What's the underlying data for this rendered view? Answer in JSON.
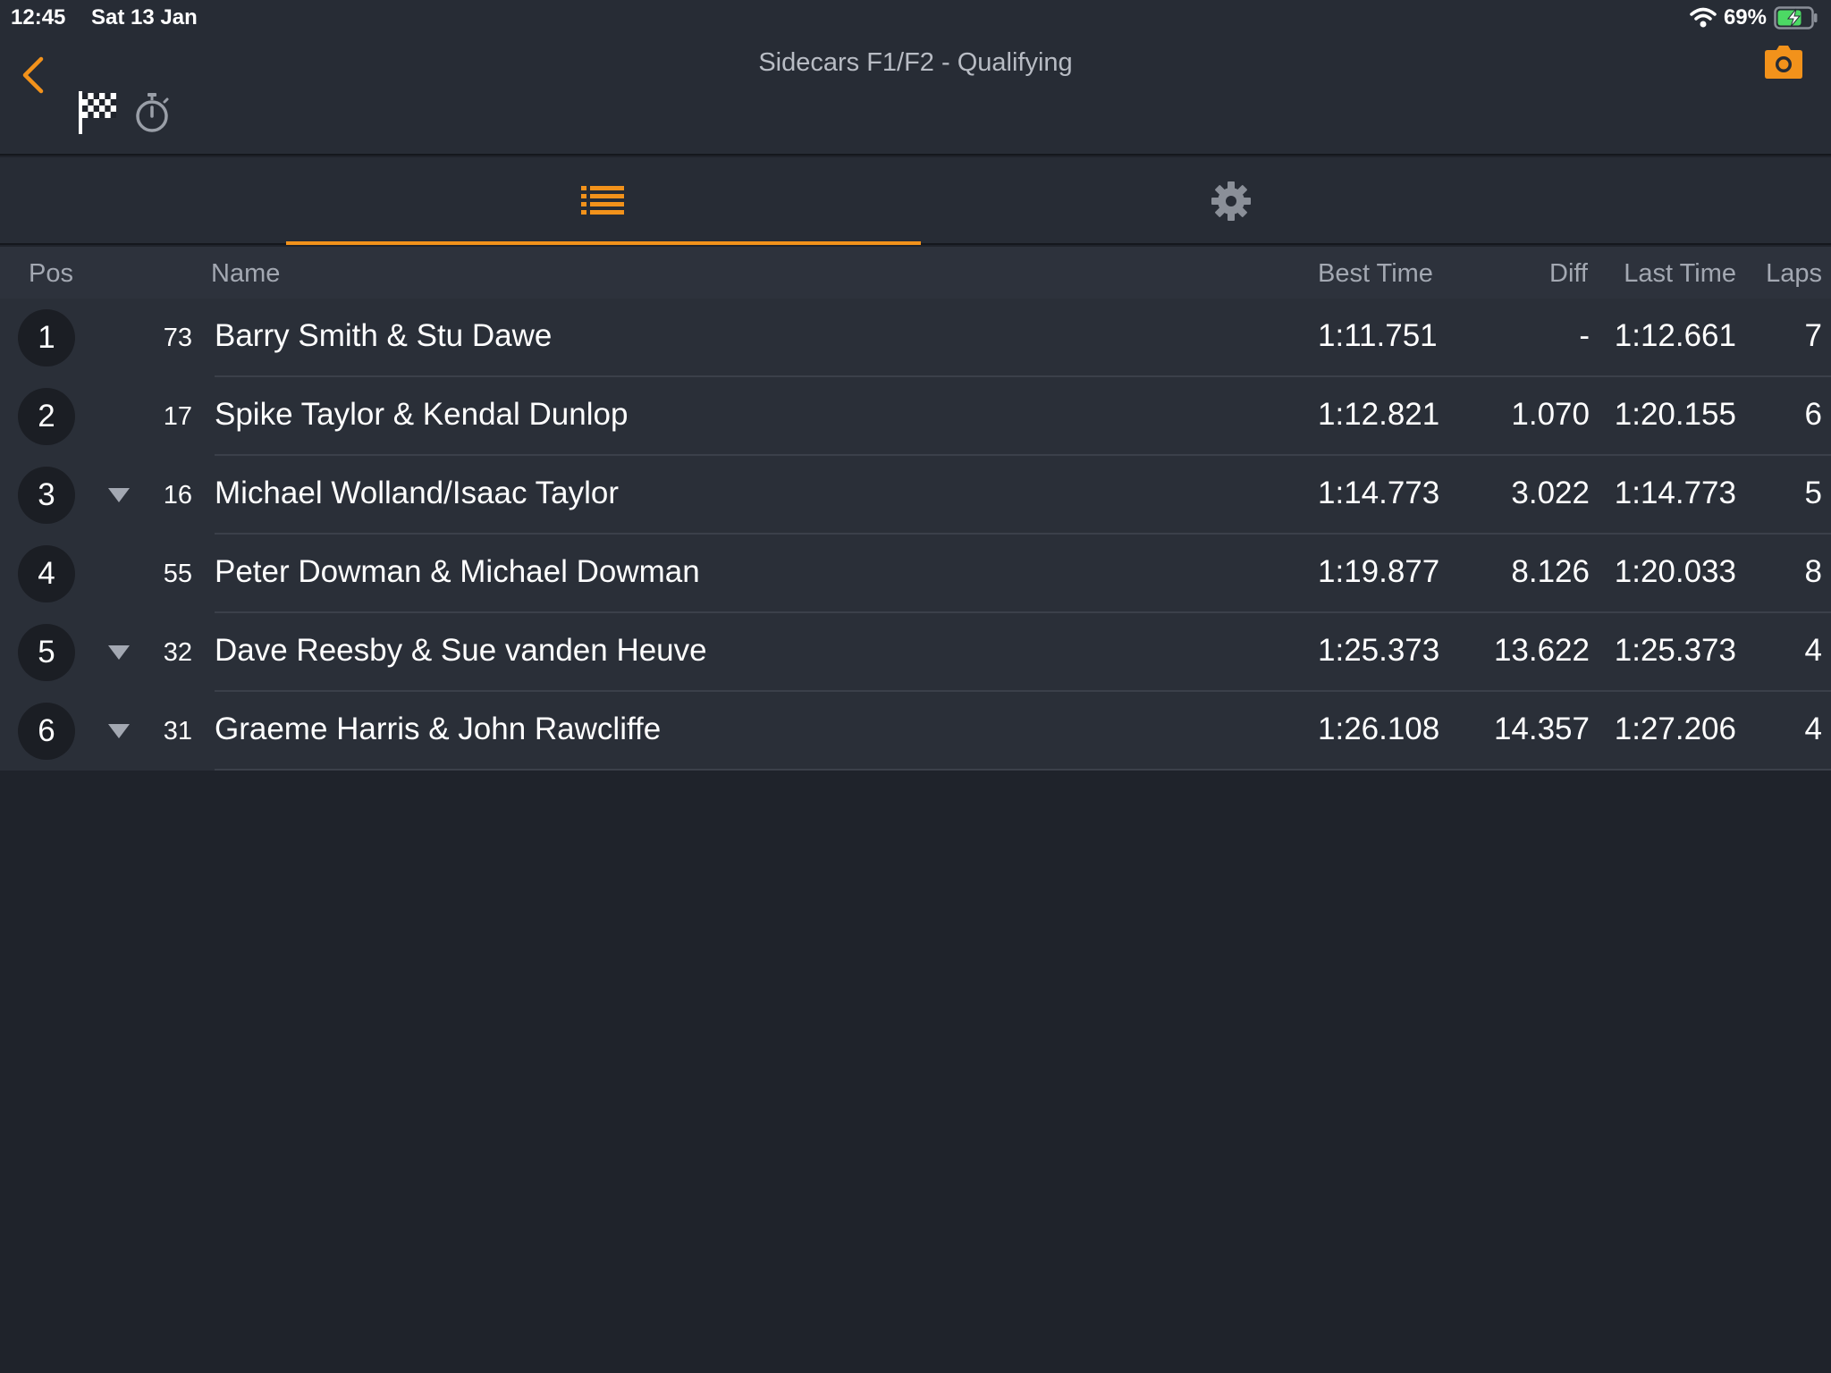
{
  "status_bar": {
    "time": "12:45",
    "date": "Sat 13 Jan",
    "battery_percent": "69%",
    "icons": [
      "wifi-icon",
      "battery-charging-icon"
    ]
  },
  "nav": {
    "title": "Sidecars F1/F2 - Qualifying",
    "icons": [
      "back-chevron-icon",
      "checkered-flag-icon",
      "stopwatch-icon",
      "camera-icon"
    ],
    "accent_color": "#f2921b"
  },
  "tabs": [
    {
      "icon": "list-icon",
      "selected": true
    },
    {
      "icon": "gear-icon",
      "selected": false
    }
  ],
  "table": {
    "headers": {
      "pos": "Pos",
      "name": "Name",
      "best_time": "Best Time",
      "diff": "Diff",
      "last_time": "Last Time",
      "laps": "Laps"
    },
    "rows": [
      {
        "pos": "1",
        "trend": "",
        "number": "73",
        "name": "Barry Smith & Stu Dawe",
        "best_time": "1:11.751",
        "diff": "-",
        "last_time": "1:12.661",
        "laps": "7"
      },
      {
        "pos": "2",
        "trend": "",
        "number": "17",
        "name": "Spike Taylor & Kendal Dunlop",
        "best_time": "1:12.821",
        "diff": "1.070",
        "last_time": "1:20.155",
        "laps": "6"
      },
      {
        "pos": "3",
        "trend": "down",
        "number": "16",
        "name": "Michael Wolland/Isaac Taylor",
        "best_time": "1:14.773",
        "diff": "3.022",
        "last_time": "1:14.773",
        "laps": "5"
      },
      {
        "pos": "4",
        "trend": "",
        "number": "55",
        "name": "Peter Dowman & Michael Dowman",
        "best_time": "1:19.877",
        "diff": "8.126",
        "last_time": "1:20.033",
        "laps": "8"
      },
      {
        "pos": "5",
        "trend": "down",
        "number": "32",
        "name": "Dave Reesby & Sue vanden Heuve",
        "best_time": "1:25.373",
        "diff": "13.622",
        "last_time": "1:25.373",
        "laps": "4"
      },
      {
        "pos": "6",
        "trend": "down",
        "number": "31",
        "name": "Graeme Harris & John Rawcliffe",
        "best_time": "1:26.108",
        "diff": "14.357",
        "last_time": "1:27.206",
        "laps": "4"
      }
    ]
  }
}
